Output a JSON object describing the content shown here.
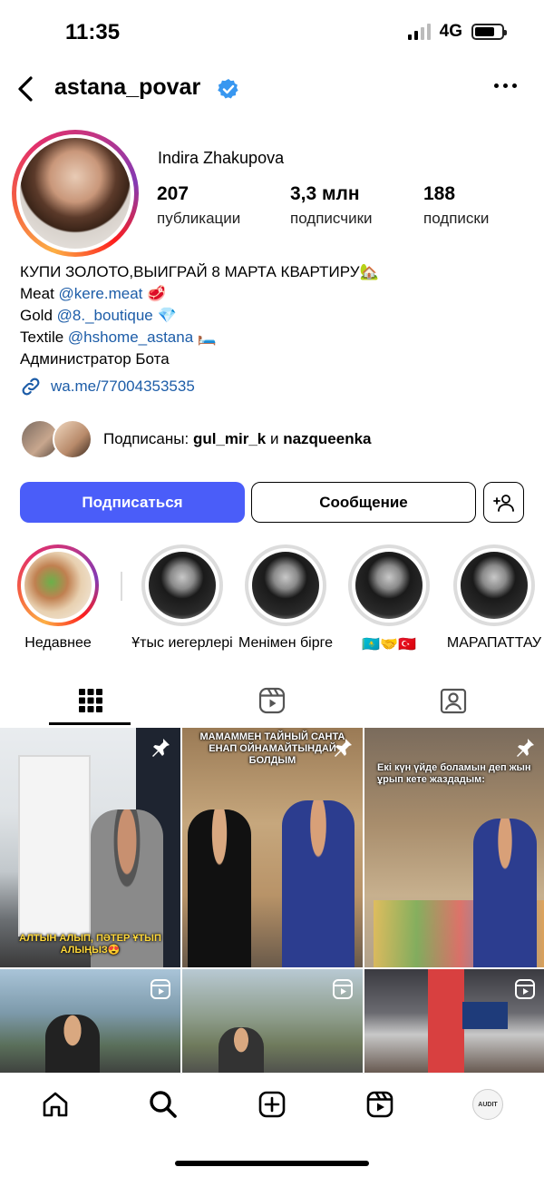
{
  "status_bar": {
    "time": "11:35",
    "network": "4G"
  },
  "header": {
    "username": "astana_povar"
  },
  "profile": {
    "full_name": "Indira Zhakupova",
    "stats": [
      {
        "value": "207",
        "label": "публикации"
      },
      {
        "value": "3,3 млн",
        "label": "подписчики"
      },
      {
        "value": "188",
        "label": "подписки"
      }
    ]
  },
  "bio": {
    "line1": "КУПИ ЗОЛОТО,ВЫИГРАЙ 8 МАРТА КВАРТИРУ🏡",
    "line2_prefix": "Meat ",
    "line2_mention": "@kere.meat",
    "line2_suffix": " 🥩",
    "line3_prefix": "Gold ",
    "line3_mention": "@8._boutique",
    "line3_suffix": " 💎",
    "line4_prefix": "Textile ",
    "line4_mention": "@hshome_astana",
    "line4_suffix": " 🛏️",
    "line5": "Администратор Бота",
    "link": "wa.me/77004353535"
  },
  "followed_by": {
    "prefix": "Подписаны: ",
    "user1": "gul_mir_k",
    "joiner": " и ",
    "user2": "nazqueenka"
  },
  "buttons": {
    "follow": "Подписаться",
    "message": "Сообщение"
  },
  "highlights": [
    {
      "label": "Недавнее"
    },
    {
      "label": "Ұтыс иегерлері"
    },
    {
      "label": "Менімен бірге"
    },
    {
      "label": "🇰🇿🤝🇹🇷"
    },
    {
      "label": "МАРАПАТТАУ"
    }
  ],
  "posts": [
    {
      "caption": "АЛТЫН АЛЫП, ПӘТЕР ҰТЫП АЛЫҢЫЗ😍",
      "pinned": true
    },
    {
      "caption": "МАМАММЕН ТАЙНЫЙ САНТА ЕНАП ОЙНАМАЙТЫНДАЙ БОЛДЫМ",
      "pinned": true
    },
    {
      "caption": "Екі күн үйде боламын деп жын ұрып кете жаздадым:",
      "pinned": true
    },
    {
      "caption": "",
      "reel": true
    },
    {
      "caption": "",
      "reel": true
    },
    {
      "caption": "",
      "reel": true
    }
  ],
  "nav": {
    "profile_avatar_text": "AUDIT"
  },
  "colors": {
    "accent_blue": "#4a5df9",
    "link_blue": "#1d5da8",
    "verified": "#3897f0"
  }
}
